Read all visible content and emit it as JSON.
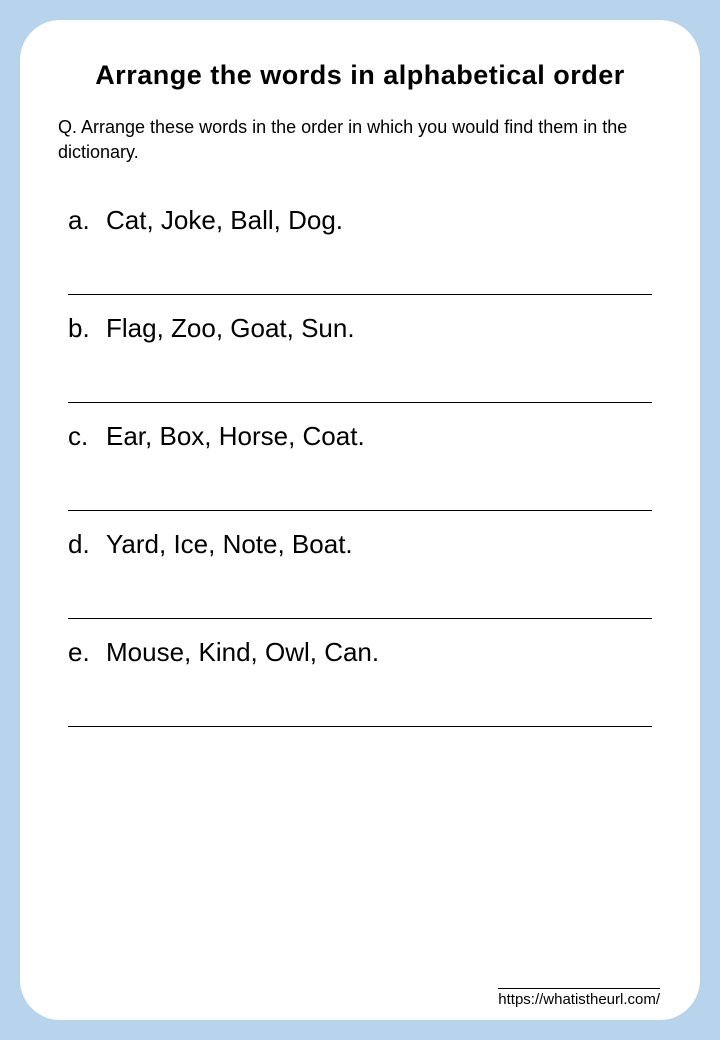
{
  "title": "Arrange the words in alphabetical order",
  "instructions": "Q. Arrange these words in the order in which you would find them in the dictionary.",
  "items": [
    {
      "label": "a.",
      "words": "Cat, Joke, Ball, Dog."
    },
    {
      "label": "b.",
      "words": "Flag, Zoo, Goat, Sun."
    },
    {
      "label": "c.",
      "words": "Ear, Box, Horse, Coat."
    },
    {
      "label": "d.",
      "words": "Yard, Ice, Note, Boat."
    },
    {
      "label": "e.",
      "words": "Mouse, Kind, Owl, Can."
    }
  ],
  "footer_url": "https://whatistheurl.com/"
}
